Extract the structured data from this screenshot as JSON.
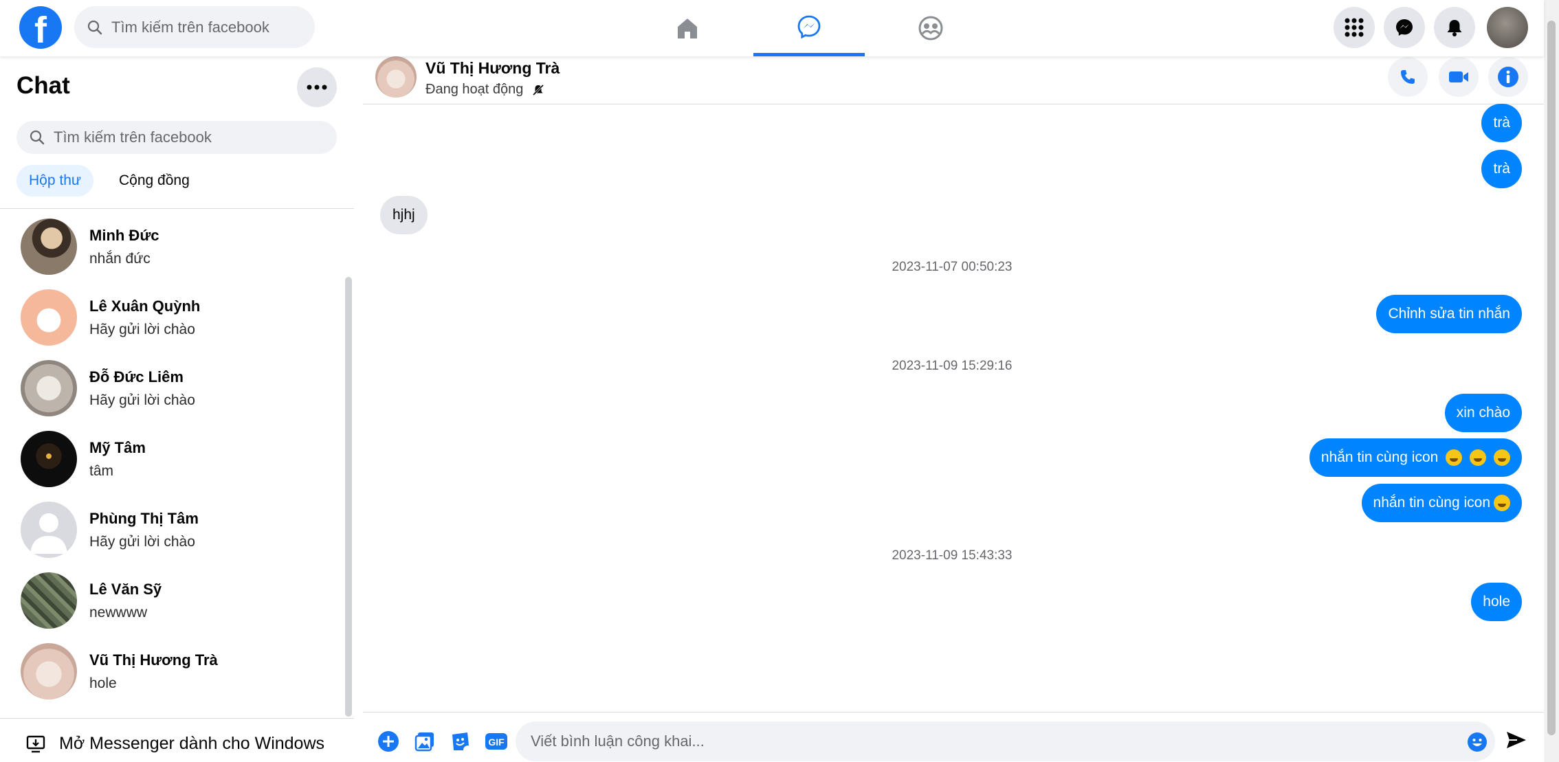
{
  "topbar": {
    "search_placeholder": "Tìm kiếm trên facebook"
  },
  "sidebar": {
    "title": "Chat",
    "search_placeholder": "Tìm kiếm trên facebook",
    "tabs": [
      {
        "label": "Hộp thư",
        "active": true
      },
      {
        "label": "Cộng đồng",
        "active": false
      }
    ],
    "conversations": [
      {
        "name": "Minh Đức",
        "preview": "nhắn đức",
        "avatar_color": "#8a7a6a"
      },
      {
        "name": "Lê Xuân Quỳnh",
        "preview": "Hãy gửi lời chào",
        "avatar_color": "#f5b89a"
      },
      {
        "name": "Đỗ Đức Liêm",
        "preview": "Hãy gửi lời chào",
        "avatar_color": "#c9c2bb"
      },
      {
        "name": "Mỹ Tâm",
        "preview": "tâm",
        "avatar_color": "#151515"
      },
      {
        "name": "Phùng Thị Tâm",
        "preview": "Hãy gửi lời chào",
        "avatar_color": "#d8dadf"
      },
      {
        "name": "Lê Văn Sỹ",
        "preview": "newwww",
        "avatar_color": "#5f6b52"
      },
      {
        "name": "Vũ Thị Hương Trà",
        "preview": "hole",
        "avatar_color": "#e6c9bd"
      }
    ],
    "open_windows_label": "Mở Messenger dành cho Windows"
  },
  "chat": {
    "contact_name": "Vũ Thị Hương Trà",
    "status": "Đang hoạt động",
    "messages": {
      "m1": "trà",
      "m2": "trà",
      "m3": "hjhj",
      "ts1": "2023-11-07 00:50:23",
      "m4": "Chỉnh sửa tin nhắn",
      "ts2": "2023-11-09 15:29:16",
      "m5": "xin chào",
      "m6": "nhắn tin cùng icon",
      "m7": "nhắn tin cùng icon",
      "ts3": "2023-11-09 15:43:33",
      "m8": "hole"
    },
    "composer_placeholder": "Viết bình luận công khai..."
  },
  "colors": {
    "accent": "#1877f2",
    "outgoing_bubble": "#0084ff",
    "incoming_bubble": "#e4e6eb"
  }
}
